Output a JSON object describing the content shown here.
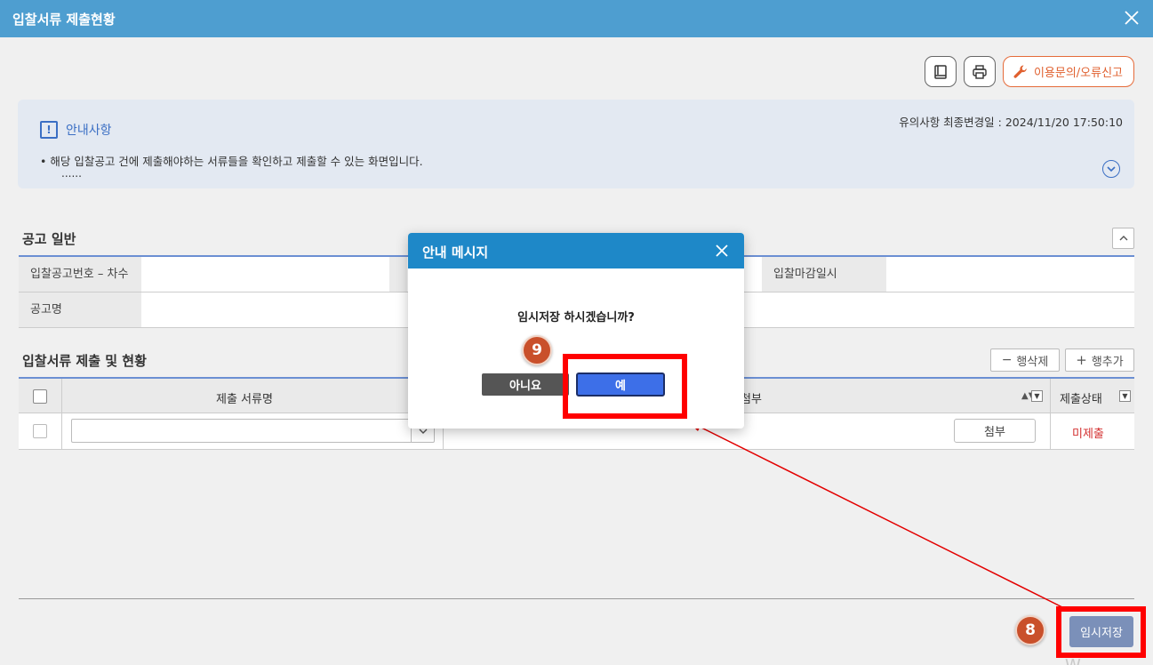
{
  "window": {
    "title": "입찰서류 제출현황",
    "close_icon": "close-icon"
  },
  "toolbar": {
    "manual_icon": "book-icon",
    "print_icon": "printer-icon",
    "report_label": "이용문의/오류신고",
    "report_icon": "wrench-icon"
  },
  "notice": {
    "title": "안내사항",
    "updated": "유의사항 최종변경일 : 2024/11/20 17:50:10",
    "bullet": "• 해당 입찰공고 건에 제출해야하는 서류들을 확인하고 제출할 수 있는 화면입니다.",
    "more": "......"
  },
  "general": {
    "title": "공고 일반",
    "bid_no_label": "입찰공고번호 – 차수",
    "deadline_label": "입찰마감일시",
    "name_label": "공고명"
  },
  "documents": {
    "title": "입찰서류 제출 및 현황",
    "delete_row": "행삭제",
    "add_row": "행추가",
    "columns": {
      "name": "제출 서류명",
      "attach": "첨부",
      "status": "제출상태"
    },
    "rows": [
      {
        "attach_button": "첨부",
        "status": "미제출"
      }
    ]
  },
  "footer": {
    "save_label": "임시저장"
  },
  "dialog": {
    "title": "안내 메시지",
    "message": "임시저장 하시겠습니까?",
    "no_label": "아니요",
    "yes_label": "예"
  },
  "annotations": {
    "step_a": "8",
    "step_b": "9"
  },
  "colors": {
    "titlebar": "#4e9ed0",
    "dialog_header": "#1e88c8",
    "primary": "#3d6fe8",
    "status_red": "#d32f2f",
    "highlight": "#ff0000",
    "badge": "#c9502b"
  }
}
